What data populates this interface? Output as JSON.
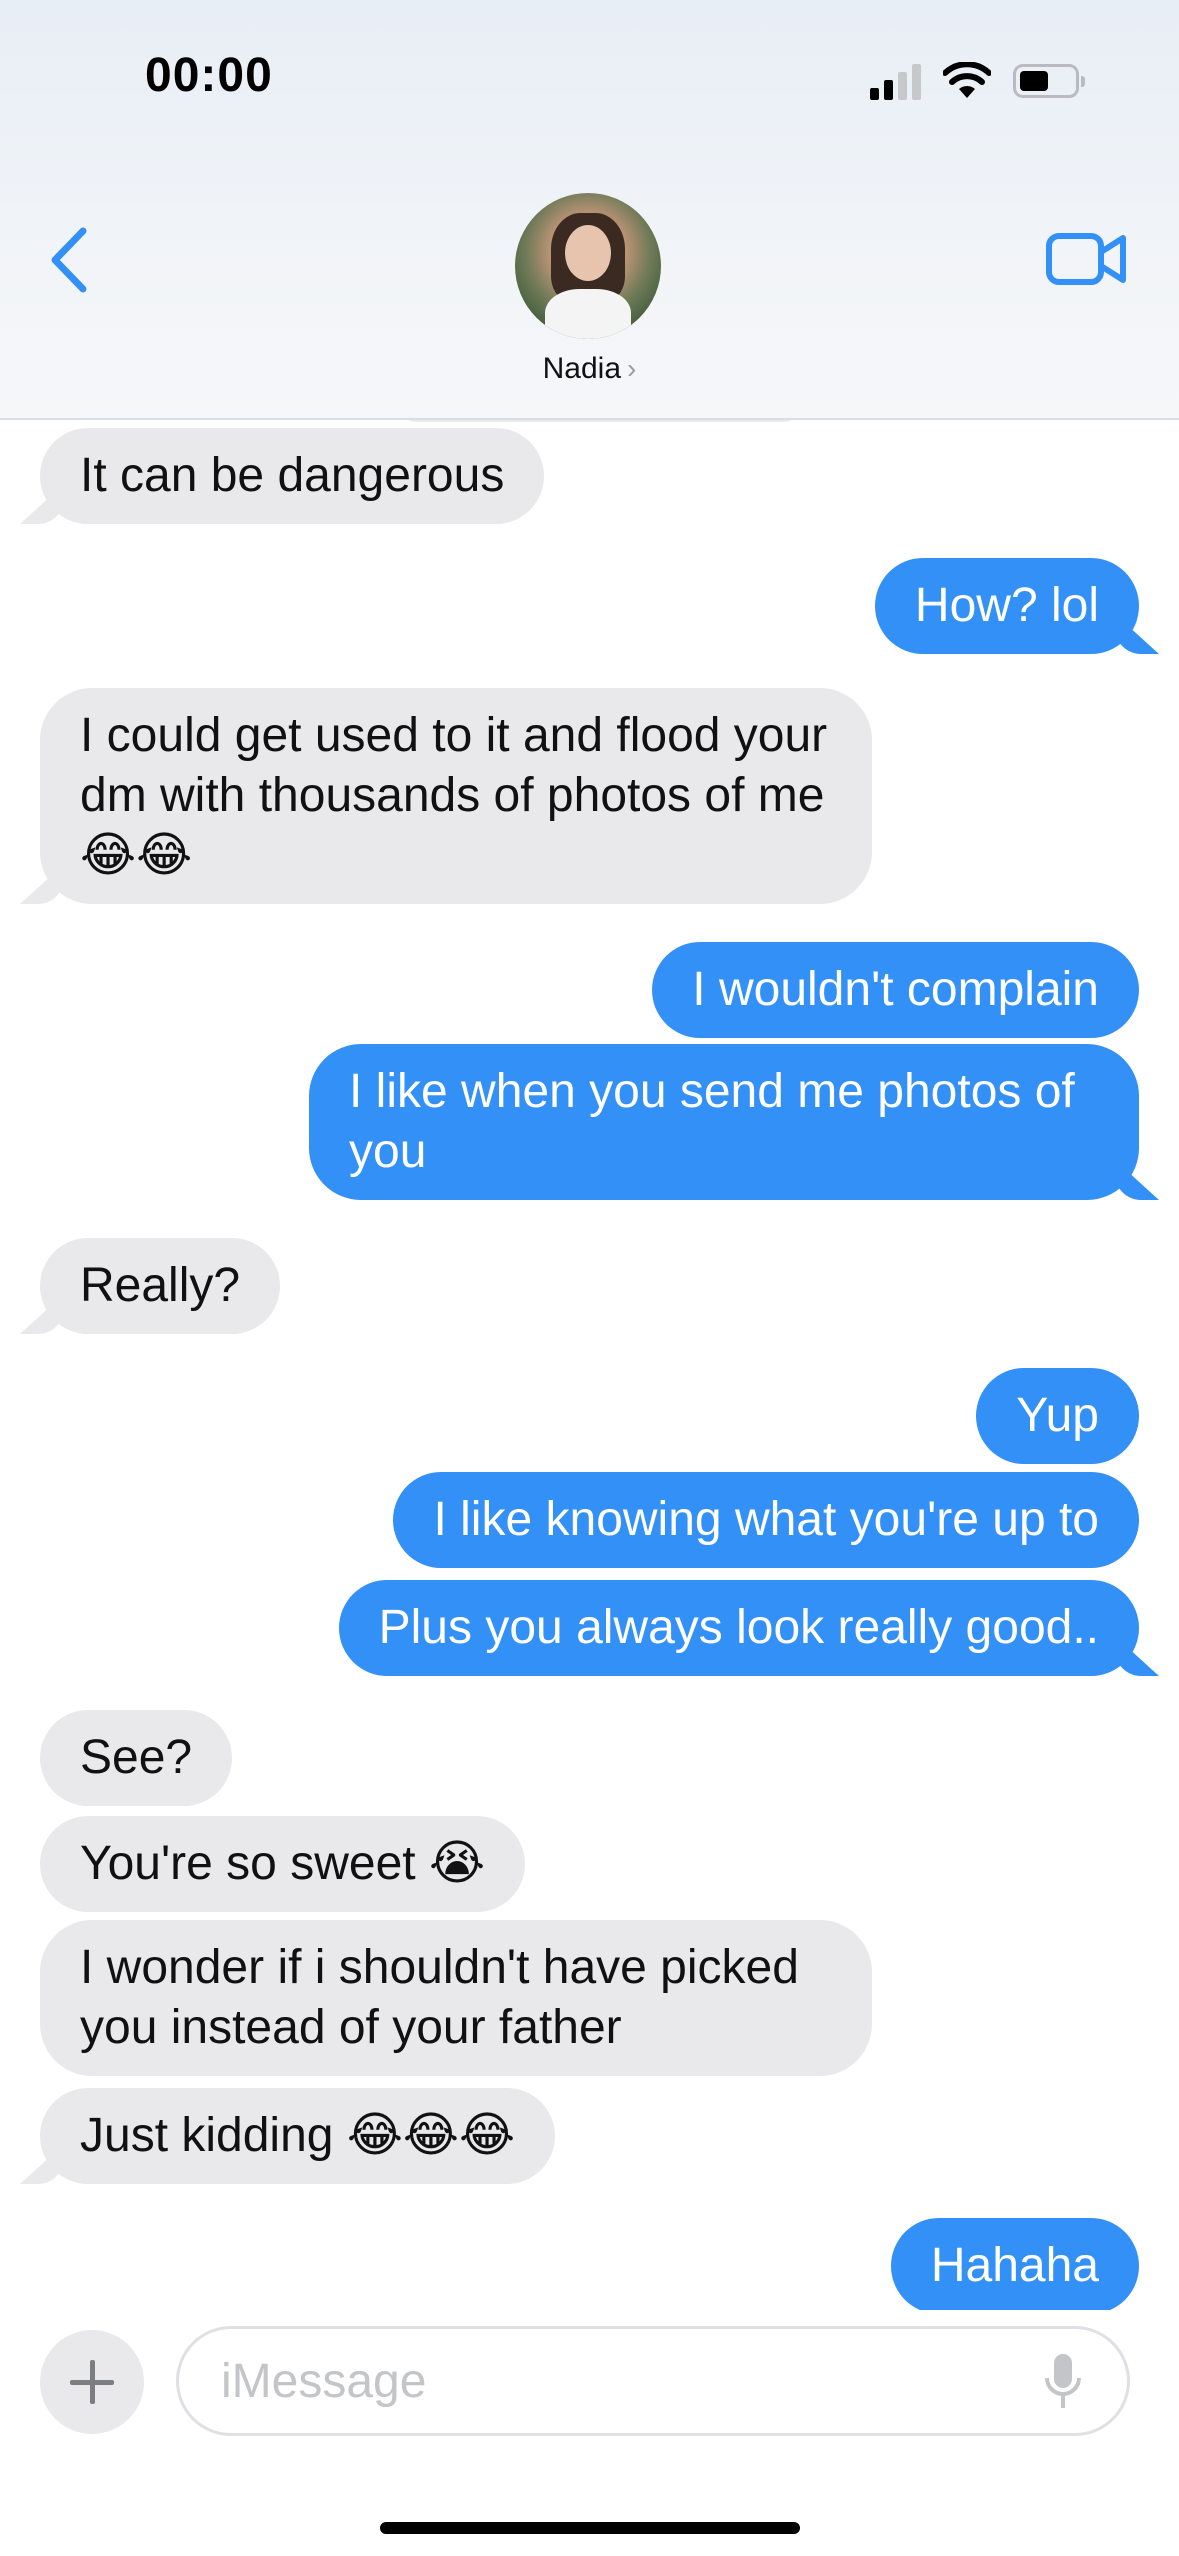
{
  "status_bar": {
    "time": "00:00"
  },
  "header": {
    "contact_name": "Nadia",
    "chevron": "›"
  },
  "messages": [
    {
      "side": "in",
      "text": "It can be dangerous"
    },
    {
      "side": "out",
      "text": "How? lol"
    },
    {
      "side": "in",
      "text": "I could get used to it and flood your dm with thousands of photos of me 😂😂"
    },
    {
      "side": "out",
      "text": "I wouldn't complain"
    },
    {
      "side": "out",
      "text": "I like when you send me photos of you"
    },
    {
      "side": "in",
      "text": "Really?"
    },
    {
      "side": "out",
      "text": "Yup"
    },
    {
      "side": "out",
      "text": "I like knowing what you're up to"
    },
    {
      "side": "out",
      "text": "Plus you always look really good.."
    },
    {
      "side": "in",
      "text": "See?"
    },
    {
      "side": "in",
      "text": "You're so sweet 😭"
    },
    {
      "side": "in",
      "text": "I wonder if i shouldn't have picked you instead of your father"
    },
    {
      "side": "in",
      "text": "Just kidding 😂😂😂"
    },
    {
      "side": "out",
      "text": "Hahaha"
    }
  ],
  "composer": {
    "placeholder": "iMessage",
    "value": ""
  },
  "icons": {
    "back": "chevron-left-icon",
    "video": "video-camera-icon",
    "plus": "plus-icon",
    "mic": "microphone-icon",
    "wifi": "wifi-icon",
    "signal": "cellular-signal-icon",
    "battery": "battery-icon"
  },
  "colors": {
    "accent": "#3390f6",
    "incoming_bubble": "#e9e9eb",
    "outgoing_text": "#ffffff"
  }
}
